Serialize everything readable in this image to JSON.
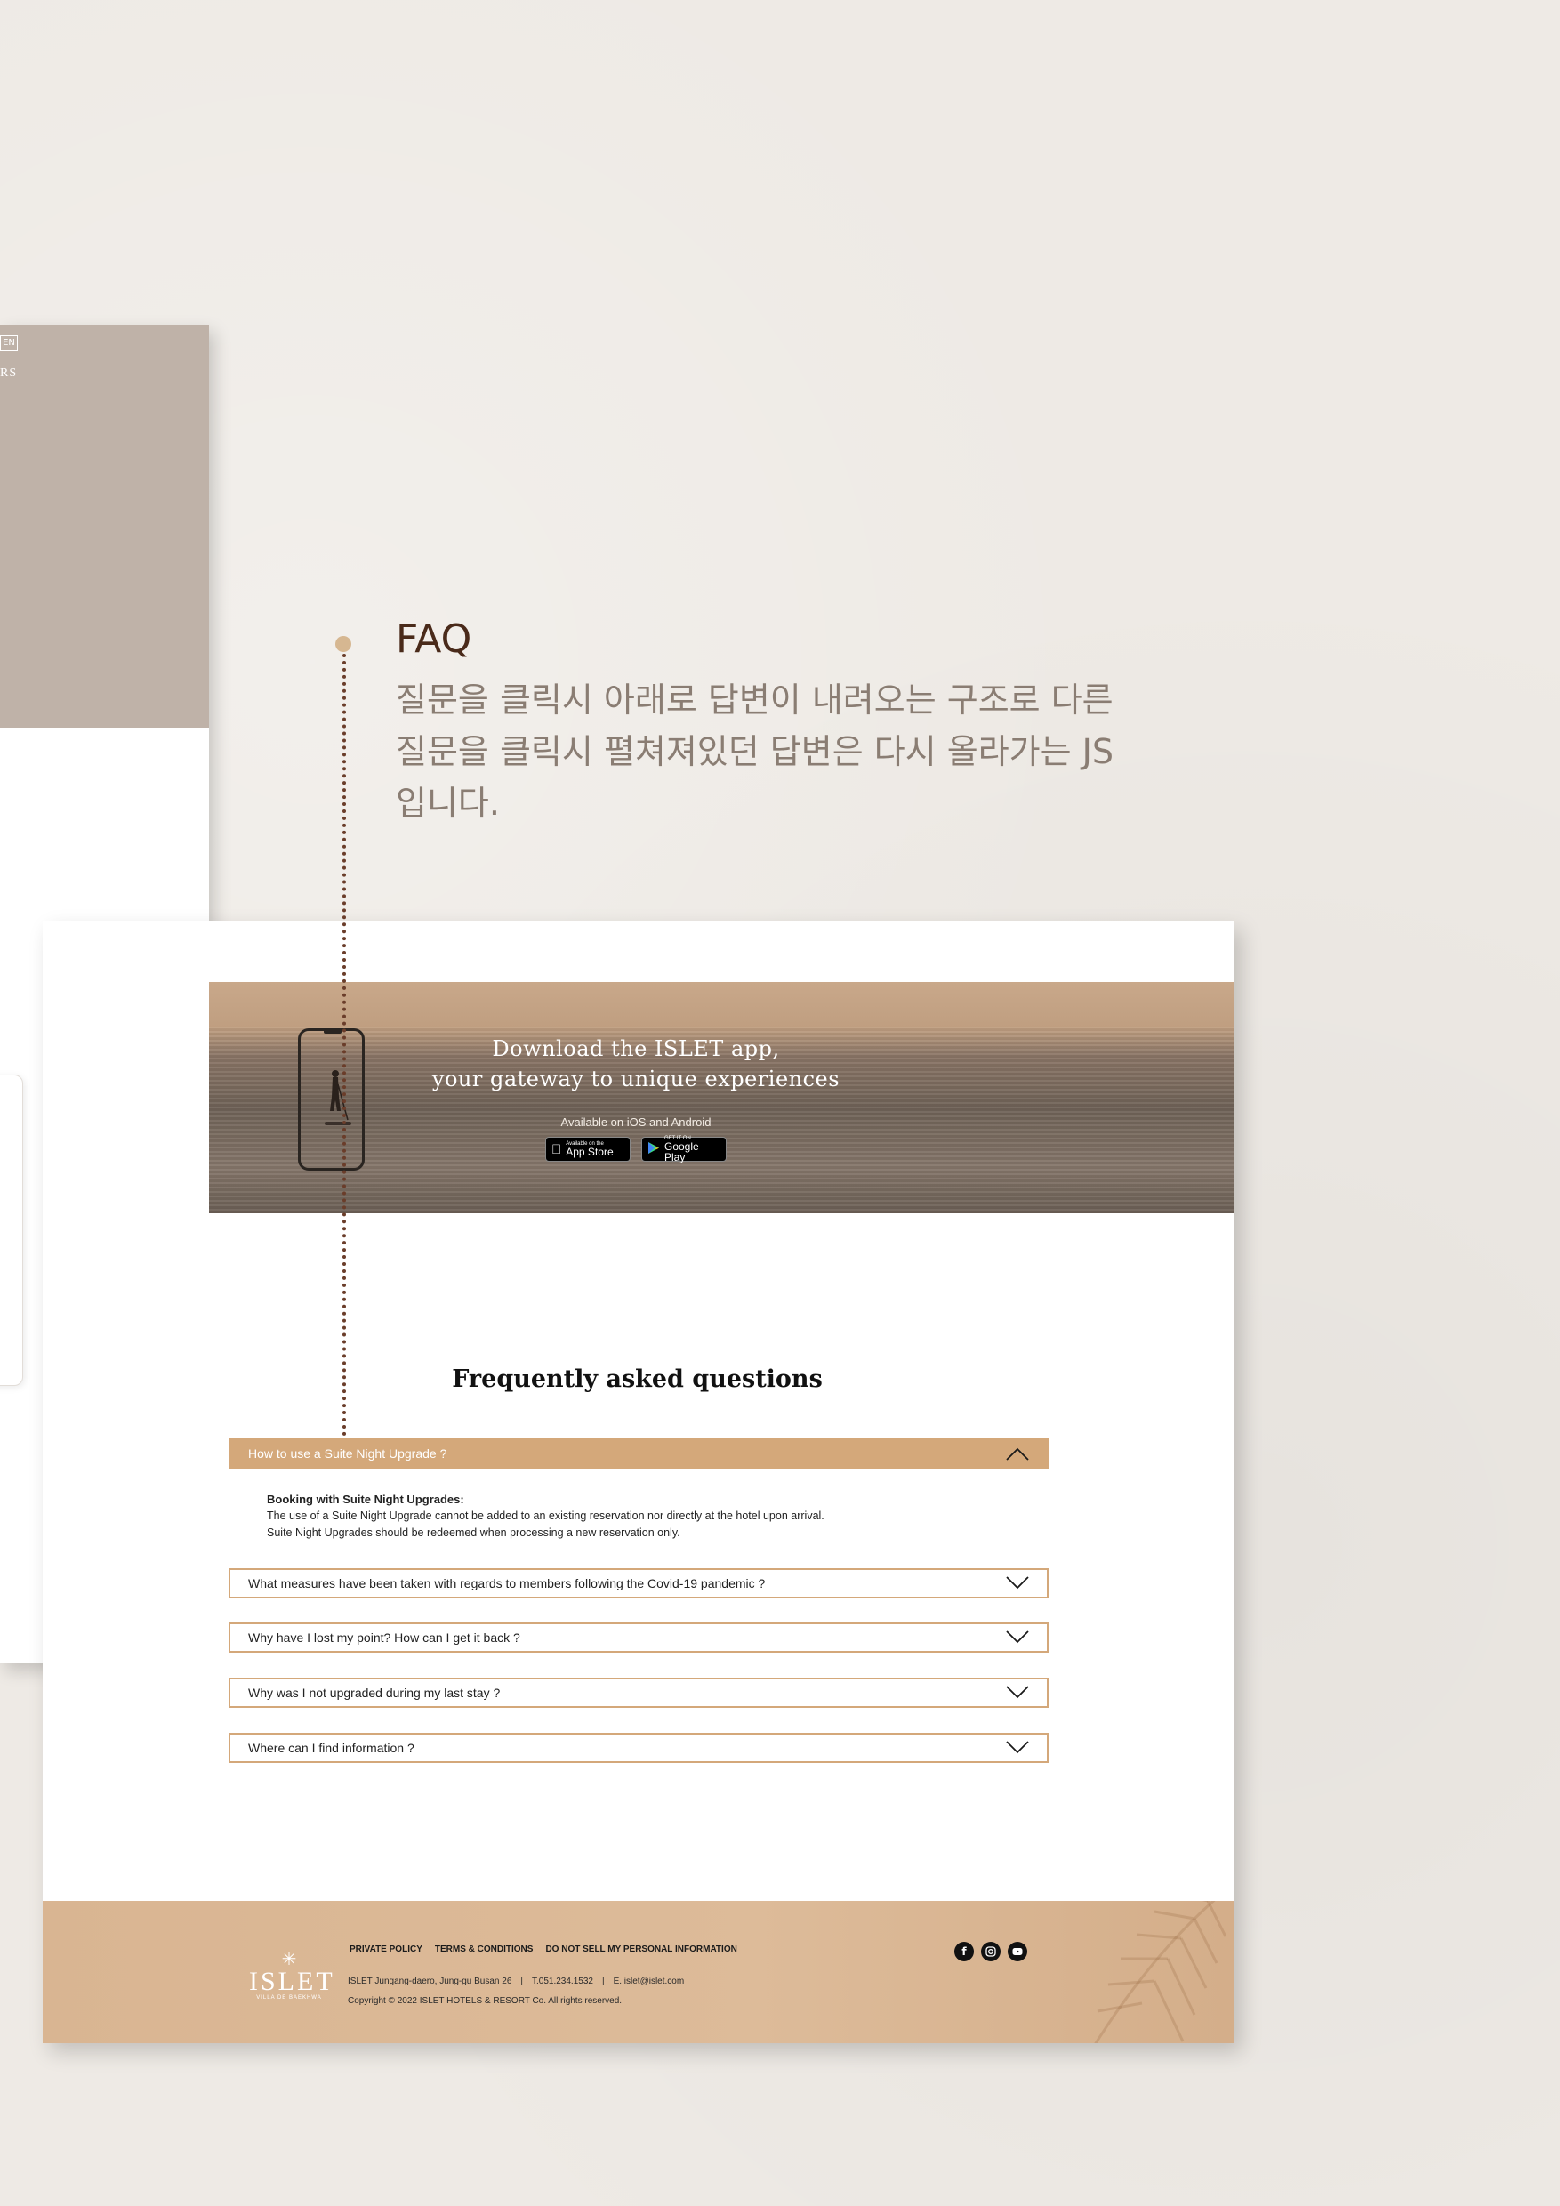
{
  "back_page": {
    "lang_badge": "EN",
    "hero_text": "RS"
  },
  "annotation": {
    "title": "FAQ",
    "description": "질문을 클릭시 아래로 답변이 내려오는 구조로 다른 질문을 클릭시 펼쳐져있던 답변은 다시 올라가는 JS입니다."
  },
  "app_banner": {
    "title_line1": "Download the ISLET app,",
    "title_line2": "your gateway to unique experiences",
    "subtitle": "Available on iOS and Android",
    "app_store": {
      "small": "Available on the",
      "big": "App Store"
    },
    "google_play": {
      "small": "GET IT ON",
      "big": "Google Play"
    }
  },
  "faq": {
    "heading": "Frequently asked questions",
    "items": [
      {
        "question": "How to use a Suite Night Upgrade ?",
        "open": true
      },
      {
        "question": "What measures have been taken with regards to members following the Covid-19 pandemic ?",
        "open": false
      },
      {
        "question": "Why have I lost my point? How can I get it back ?",
        "open": false
      },
      {
        "question": "Why was I not upgraded during my last stay ?",
        "open": false
      },
      {
        "question": "Where can I find information ?",
        "open": false
      }
    ],
    "answer": {
      "title": "Booking with Suite Night Upgrades:",
      "line1": "The use of a Suite Night Upgrade cannot be added to an existing reservation nor directly at the hotel upon arrival.",
      "line2": "Suite Night Upgrades should be redeemed when processing a new reservation only."
    }
  },
  "footer": {
    "logo_name": "ISLET",
    "logo_tag": "VILLA DE BAEKHWA",
    "links": [
      "PRIVATE POLICY",
      "TERMS & CONDITIONS",
      "DO NOT SELL MY PERSONAL INFORMATION"
    ],
    "address": "ISLET Jungang-daero, Jung-gu Busan 26",
    "phone": "T.051.234.1532",
    "email": "E. islet@islet.com",
    "sep": "|",
    "copyright": "Copyright © 2022 ISLET HOTELS & RESORT Co. All rights reserved.",
    "social": [
      "facebook-icon",
      "instagram-icon",
      "youtube-icon"
    ]
  },
  "colors": {
    "accent": "#d4a87a",
    "annotation_dot": "#d6b791",
    "annotation_line": "#6a3d2a",
    "background": "#eeeae5"
  }
}
